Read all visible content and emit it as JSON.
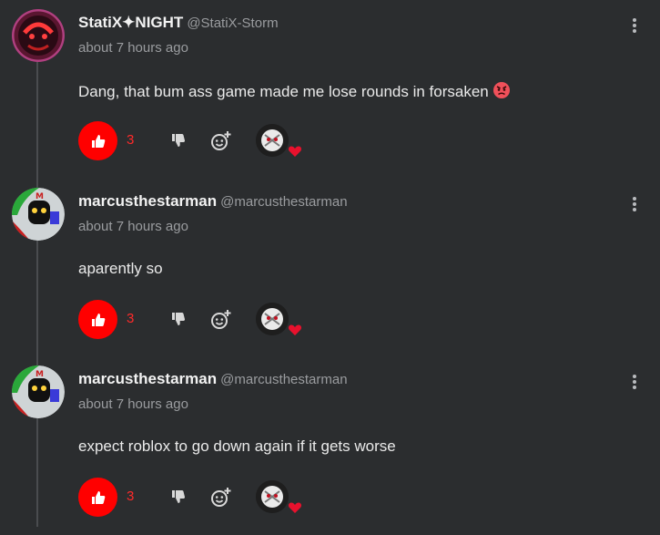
{
  "colors": {
    "background": "#2b2d2f",
    "like_active": "#ff0000",
    "like_count": "#ff2a2a",
    "muted_text": "#9a9c9f",
    "heart": "#e8112d"
  },
  "comments": [
    {
      "username": "StatiX✦NIGHT",
      "handle": "@StatiX-Storm",
      "timestamp": "about 7 hours ago",
      "text": "Dang, that bum ass game made me lose rounds in forsaken",
      "emoji": "angry-face-emoji",
      "likes": "3",
      "liked": true,
      "reaction_icon": "heart-icon"
    },
    {
      "username": "marcusthestarman",
      "handle": "@marcusthestarman",
      "timestamp": "about 7 hours ago",
      "text": "aparently so",
      "likes": "3",
      "liked": true,
      "reaction_icon": "heart-icon"
    },
    {
      "username": "marcusthestarman",
      "handle": "@marcusthestarman",
      "timestamp": "about 7 hours ago",
      "text": "expect roblox to go down again if it gets worse",
      "likes": "3",
      "liked": true,
      "reaction_icon": "heart-icon"
    }
  ]
}
